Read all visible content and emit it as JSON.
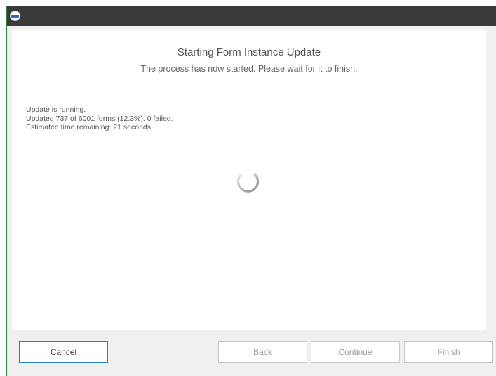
{
  "window": {
    "icon": "app-logo-icon",
    "accent_color": "#2f8a3a"
  },
  "header": {
    "title": "Starting Form Instance Update",
    "subtitle": "The process has now started. Please wait for it to finish."
  },
  "status": {
    "lines": [
      "Update is running.",
      "Updated 737 of 6001 forms (12.3%). 0 failed.",
      "Estimated time remaining: 21 seconds"
    ]
  },
  "spinner": {
    "icon": "loading-spinner-icon"
  },
  "buttons": {
    "cancel": "Cancel",
    "back": "Back",
    "continue": "Continue",
    "finish": "Finish"
  }
}
